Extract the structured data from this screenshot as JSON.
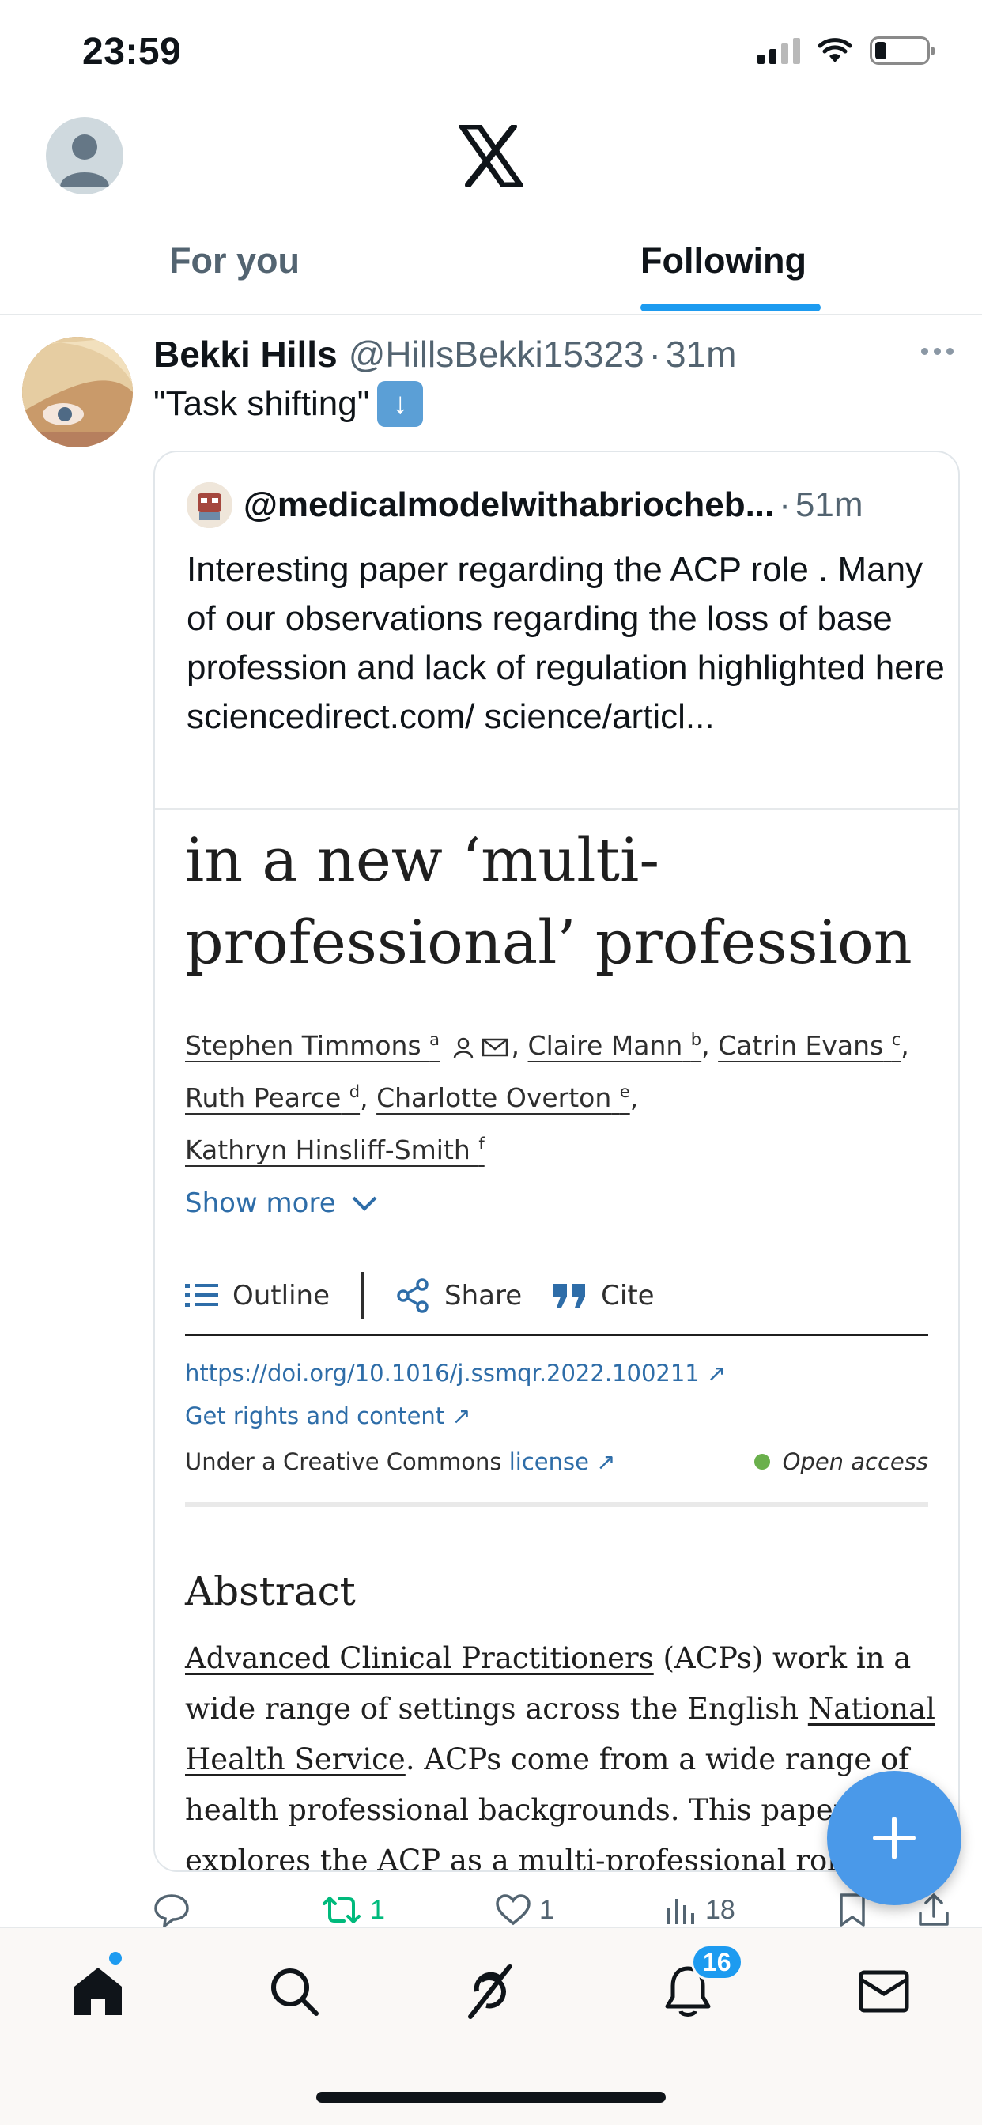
{
  "status_bar": {
    "time": "23:59"
  },
  "header": {
    "tabs": [
      {
        "label": "For you"
      },
      {
        "label": "Following"
      }
    ]
  },
  "tweet": {
    "author_name": "Bekki Hills",
    "author_handle": "@HillsBekki15323",
    "separator": "·",
    "time": "31m",
    "text": "\"Task shifting\"",
    "quoted": {
      "handle": "@medicalmodelwithabriocheb...",
      "separator": "·",
      "time": "51m",
      "text": "Interesting paper regarding the ACP role . Many of our observations regarding the loss of base profession and lack of regulation highlighted here  sciencedirect.com/ science/articl...",
      "paper": {
        "title": "in a new ‘multi-professional’ profession",
        "authors": [
          {
            "name": "Stephen Timmons",
            "sup": "a"
          },
          {
            "name": "Claire Mann",
            "sup": "b"
          },
          {
            "name": "Catrin Evans",
            "sup": "c"
          },
          {
            "name": "Ruth Pearce",
            "sup": "d"
          },
          {
            "name": "Charlotte Overton",
            "sup": "e"
          },
          {
            "name": "Kathryn Hinsliff-Smith",
            "sup": "f"
          }
        ],
        "show_more": "Show more",
        "actions": {
          "outline": "Outline",
          "share": "Share",
          "cite": "Cite"
        },
        "doi": "https://doi.org/10.1016/j.ssmqr.2022.100211",
        "rights": "Get rights and content",
        "license_prefix": "Under a Creative Commons",
        "license_link": "license",
        "open_access": "Open access",
        "abstract_heading": "Abstract",
        "abstract_parts": {
          "a": "Advanced Clinical Practitioners",
          "b": " (ACPs) work in a wide range of settings across the English ",
          "c": "National Health Service",
          "d": ". ACPs come from a wide range of health professional backgrounds. This paper explores the ACP as a multi-professional role"
        }
      }
    },
    "engagement": {
      "replies": "",
      "reposts": "1",
      "likes": "1",
      "views": "18"
    }
  },
  "nav": {
    "notifications_badge": "16"
  },
  "colors": {
    "accent": "#1d9bf0",
    "repost_active": "#00ba7c",
    "link": "#2e6da8"
  },
  "icons": [
    "profile-avatar-icon",
    "x-logo-icon",
    "more-icon",
    "reply-icon",
    "repost-icon",
    "like-icon",
    "views-icon",
    "bookmark-icon",
    "share-icon",
    "compose-icon",
    "home-icon",
    "search-icon",
    "grok-icon",
    "bell-icon",
    "mail-icon"
  ]
}
